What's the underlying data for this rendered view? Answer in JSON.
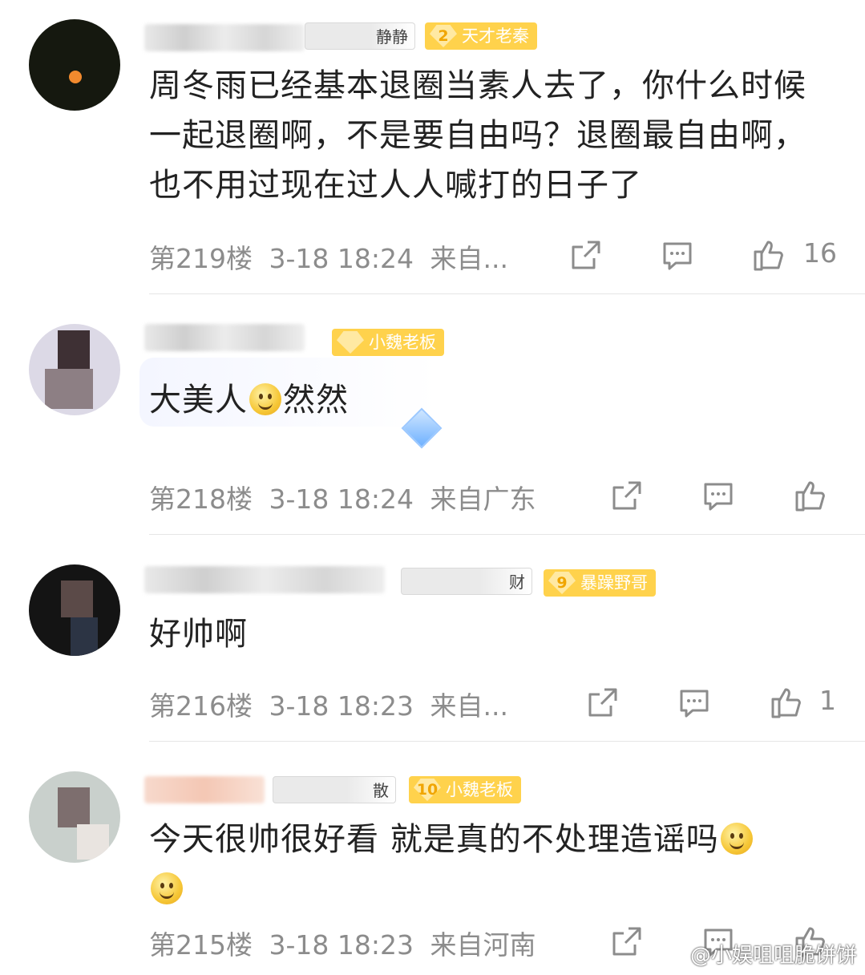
{
  "comments": [
    {
      "name_visible": "静静",
      "badge_level": "2",
      "badge_label": "天才老秦",
      "text": "周冬雨已经基本退圈当素人去了，你什么时候一起退圈啊，不是要自由吗？退圈最自由啊，也不用过现在过人人喊打的日子了",
      "floor": "第219楼",
      "time": "3-18 18:24",
      "location": "来自...",
      "likes": "16"
    },
    {
      "name_visible": "",
      "badge_level": "",
      "badge_label": "小魏老板",
      "text_before": "大美人",
      "text_after": "然然",
      "floor": "第218楼",
      "time": "3-18 18:24",
      "location": "来自广东",
      "likes": ""
    },
    {
      "name_visible": "财",
      "badge_level": "9",
      "badge_label": "暴躁野哥",
      "text": "好帅啊",
      "floor": "第216楼",
      "time": "3-18 18:23",
      "location": "来自...",
      "likes": "1"
    },
    {
      "name_visible": "散",
      "badge_level": "10",
      "badge_label": "小魏老板",
      "text": "今天很帅很好看 就是真的不处理造谣吗",
      "floor": "第215楼",
      "time": "3-18 18:23",
      "location": "来自河南",
      "likes": ""
    }
  ],
  "icons": {
    "share": "share-icon",
    "comment": "comment-icon",
    "like": "thumbs-up-icon"
  },
  "colors": {
    "badge_bg": "#ffd24c",
    "meta_text": "#8c8c8c",
    "body_text": "#222222"
  },
  "watermark": "@小娱咀咀脆饼饼"
}
